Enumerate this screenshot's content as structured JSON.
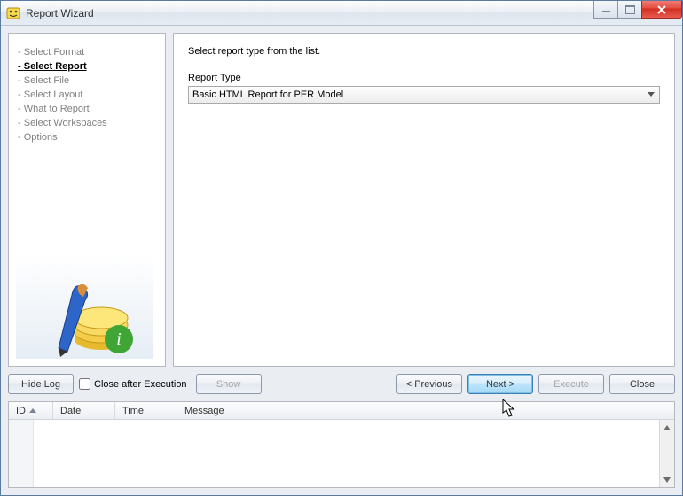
{
  "window": {
    "title": "Report Wizard"
  },
  "steps": [
    "Select Format",
    "Select Report",
    "Select File",
    "Select Layout",
    "What to Report",
    "Select Workspaces",
    "Options"
  ],
  "active_step_index": 1,
  "main": {
    "instruction": "Select report type from the list.",
    "field_label": "Report Type",
    "selected_value": "Basic HTML Report for PER Model",
    "options": [
      "Basic HTML Report for PER Model"
    ]
  },
  "buttons": {
    "hide_log": "Hide Log",
    "close_after_exec": "Close after Execution",
    "show": "Show",
    "previous": "< Previous",
    "next": "Next >",
    "execute": "Execute",
    "close": "Close"
  },
  "close_after_exec_checked": false,
  "log": {
    "columns": {
      "id": "ID",
      "date": "Date",
      "time": "Time",
      "message": "Message"
    }
  }
}
